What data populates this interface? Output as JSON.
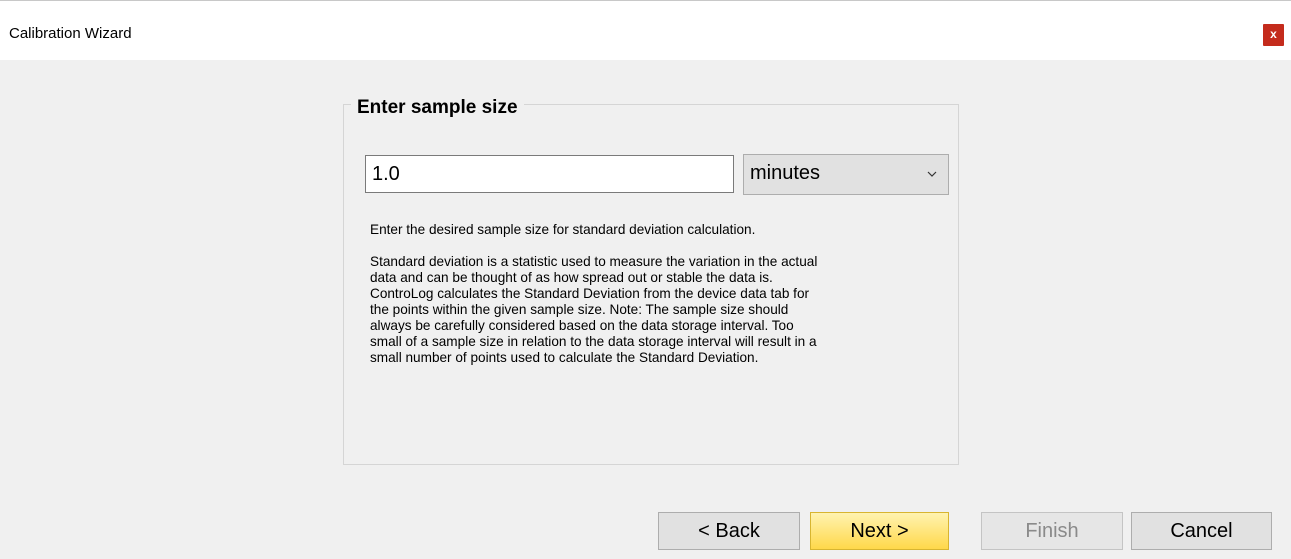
{
  "window": {
    "title": "Calibration Wizard",
    "close_label": "x",
    "close_color": "#c42b1c"
  },
  "group": {
    "legend": "Enter sample size"
  },
  "sample": {
    "value": "1.0",
    "unit": "minutes"
  },
  "description": {
    "intro": "Enter the desired sample size for standard deviation calculation.",
    "lines": [
      "Standard deviation is a statistic used to measure the variation in the actual",
      "data and can be thought of as how spread out or stable the data is.",
      "ControLog calculates the Standard Deviation from the device data tab for",
      "the points within the given sample size.  Note: The sample size should",
      "always be carefully considered based on the data storage interval.  Too",
      "small of a sample size in relation to the data storage interval will result in a",
      "small number of points used to calculate the Standard Deviation."
    ]
  },
  "buttons": {
    "back": "< Back",
    "next": "Next >",
    "finish": "Finish",
    "cancel": "Cancel",
    "next_color": "#ffd84a"
  },
  "icons": {
    "close": "close-icon",
    "dropdown": "chevron-down-icon"
  }
}
